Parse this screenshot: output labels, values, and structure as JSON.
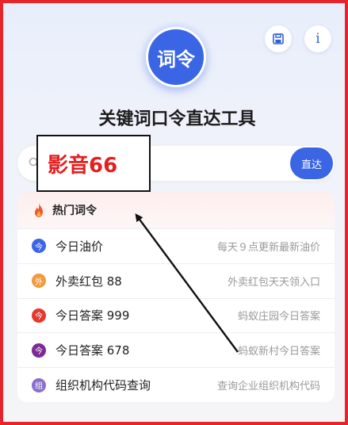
{
  "header": {
    "logo_text": "词令",
    "title": "关键词口令直达工具",
    "save_icon": "save-icon",
    "info_label": "i"
  },
  "search": {
    "value": "",
    "placeholder": "",
    "go_label": "直达"
  },
  "annotation": {
    "text": "影音66"
  },
  "hot_list": {
    "header_label": "热门词令",
    "items": [
      {
        "badge": "今",
        "name": "今日油价",
        "desc": "每天９点更新最新油价",
        "color": "#3a66e6"
      },
      {
        "badge": "外",
        "name": "外卖红包 88",
        "desc": "外卖红包天天领入口",
        "color": "#f19a3e"
      },
      {
        "badge": "今",
        "name": "今日答案 999",
        "desc": "蚂蚁庄园今日答案",
        "color": "#e4392f"
      },
      {
        "badge": "今",
        "name": "今日答案 678",
        "desc": "蚂蚁新村今日答案",
        "color": "#7b2a96"
      },
      {
        "badge": "组",
        "name": "组织机构代码查询",
        "desc": "查询企业组织机构代码",
        "color": "#8a6fd0"
      }
    ]
  },
  "colors": {
    "accent": "#3a66e6",
    "frame_border": "#e8242b",
    "annotation_text": "#e41f1f"
  }
}
